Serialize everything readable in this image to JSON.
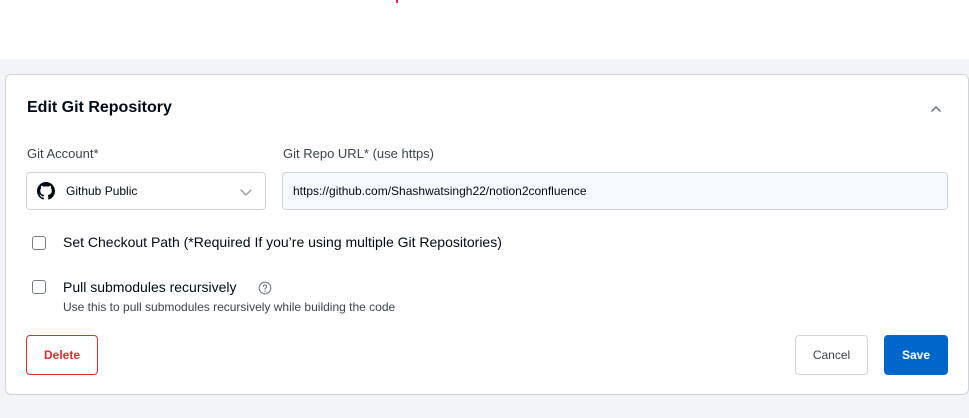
{
  "form": {
    "title": "Edit Git Repository",
    "git_account_label": "Git Account*",
    "git_account_value": "Github Public",
    "repo_url_label": "Git Repo URL* (use https)",
    "repo_url_value": "https://github.com/Shashwatsingh22/notion2confluence",
    "checkout_path_label": "Set Checkout Path (*Required If you’re using multiple Git Repositories)",
    "checkout_path_checked": false,
    "submodules_label": "Pull submodules recursively",
    "submodules_checked": false,
    "submodules_help": "Use this to pull submodules recursively while building the code"
  },
  "actions": {
    "delete_label": "Delete",
    "cancel_label": "Cancel",
    "save_label": "Save"
  },
  "colors": {
    "primary": "#0066cc",
    "danger": "#e02b2b",
    "border": "#d0d4d9"
  },
  "icons": [
    "chevron-up-icon",
    "github-icon",
    "chevron-down-icon",
    "help-icon"
  ]
}
